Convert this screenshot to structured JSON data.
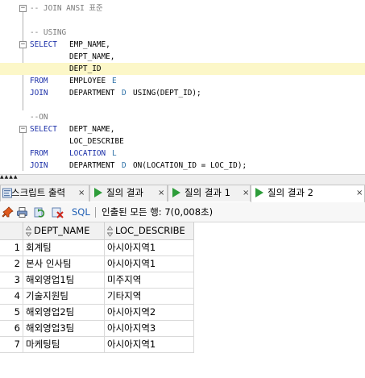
{
  "editor": {
    "lines": [
      {
        "parts": [
          {
            "t": "-- JOIN ANSI 표준",
            "c": "cm"
          }
        ],
        "fold": "minus"
      },
      {
        "parts": []
      },
      {
        "parts": [
          {
            "t": "-- USING",
            "c": "cm"
          }
        ]
      },
      {
        "parts": [
          {
            "t": "SELECT",
            "c": "kw"
          },
          {
            "t": "EMP_NAME,",
            "c": "tx"
          }
        ],
        "fold": "minus"
      },
      {
        "parts": [
          {
            "t": "DEPT_NAME,",
            "c": "tx"
          }
        ]
      },
      {
        "parts": [
          {
            "t": "DEPT_ID",
            "c": "tx"
          }
        ],
        "highlight": true
      },
      {
        "parts": [
          {
            "t": "FROM",
            "c": "kw"
          },
          {
            "t": "EMPLOYEE",
            "c": "tx"
          },
          {
            "t": "E",
            "c": "alias"
          }
        ]
      },
      {
        "parts": [
          {
            "t": "JOIN",
            "c": "kw"
          },
          {
            "t": "DEPARTMENT",
            "c": "tx"
          },
          {
            "t": "D",
            "c": "alias"
          },
          {
            "t": "USING(DEPT_ID);",
            "c": "tx"
          }
        ]
      },
      {
        "parts": []
      },
      {
        "parts": [
          {
            "t": "--ON",
            "c": "cm"
          }
        ]
      },
      {
        "parts": [
          {
            "t": "SELECT",
            "c": "kw"
          },
          {
            "t": "DEPT_NAME,",
            "c": "tx"
          }
        ],
        "fold": "minus"
      },
      {
        "parts": [
          {
            "t": "LOC_DESCRIBE",
            "c": "tx"
          }
        ]
      },
      {
        "parts": [
          {
            "t": "FROM",
            "c": "kw"
          },
          {
            "t": "LOCATION",
            "c": "kw"
          },
          {
            "t": "L",
            "c": "alias"
          }
        ]
      },
      {
        "parts": [
          {
            "t": "JOIN",
            "c": "kw"
          },
          {
            "t": "DEPARTMENT",
            "c": "tx"
          },
          {
            "t": "D",
            "c": "alias"
          },
          {
            "t": "ON(LOCATION_ID = LOC_ID);",
            "c": "tx"
          }
        ]
      }
    ]
  },
  "tabs": [
    {
      "label": "스크립트 출력",
      "close": "×",
      "icon": "script-output-icon"
    },
    {
      "label": "질의 결과",
      "close": "×",
      "icon": "query-result-icon"
    },
    {
      "label": "질의 결과 1",
      "close": "×",
      "icon": "query-result-icon"
    },
    {
      "label": "질의 결과 2",
      "close": "×",
      "icon": "query-result-icon",
      "active": true
    }
  ],
  "toolbar": {
    "sql_label": "SQL",
    "status": "인출된 모든 행: 7(0,008초)"
  },
  "grid": {
    "columns": [
      "DEPT_NAME",
      "LOC_DESCRIBE"
    ],
    "rows": [
      {
        "n": "1",
        "dept_name": "회계팀",
        "loc_describe": "아시아지역1"
      },
      {
        "n": "2",
        "dept_name": "본사 인사팀",
        "loc_describe": "아시아지역1"
      },
      {
        "n": "3",
        "dept_name": "해외영업1팀",
        "loc_describe": "미주지역"
      },
      {
        "n": "4",
        "dept_name": "기술지원팀",
        "loc_describe": "기타지역"
      },
      {
        "n": "5",
        "dept_name": "해외영업2팀",
        "loc_describe": "아시아지역2"
      },
      {
        "n": "6",
        "dept_name": "해외영업3팀",
        "loc_describe": "아시아지역3"
      },
      {
        "n": "7",
        "dept_name": "마케팅팀",
        "loc_describe": "아시아지역1"
      }
    ]
  },
  "colors": {
    "keyword": "#1b2fa8",
    "comment": "#7b7b7b",
    "highlight_line": "#fcf7c8",
    "run_triangle": "#2e9d3a",
    "sql_link": "#1f5fb5"
  }
}
